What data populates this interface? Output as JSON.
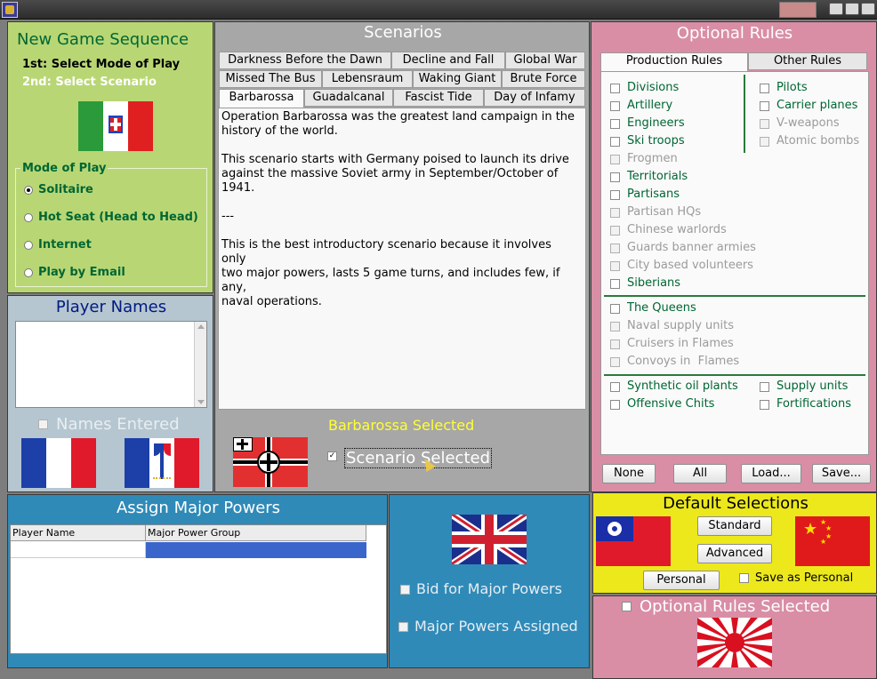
{
  "new_game": {
    "title": "New Game Sequence",
    "step1": "1st: Select Mode of Play",
    "step2": "2nd: Select Scenario",
    "mode_group_label": "Mode of Play",
    "modes": [
      {
        "label": "Solitaire",
        "selected": true
      },
      {
        "label": "Hot Seat (Head to Head)",
        "selected": false
      },
      {
        "label": "Internet",
        "selected": false
      },
      {
        "label": "Play by Email",
        "selected": false
      }
    ]
  },
  "player_names": {
    "title": "Player Names",
    "names_entered_label": "Names Entered"
  },
  "scenarios": {
    "title": "Scenarios",
    "tabs_row1": [
      "Darkness Before the Dawn",
      "Decline and Fall",
      "Global War"
    ],
    "tabs_row2": [
      "Missed The Bus",
      "Lebensraum",
      "Waking Giant",
      "Brute Force"
    ],
    "tabs_row3": [
      "Barbarossa",
      "Guadalcanal",
      "Fascist Tide",
      "Day of Infamy"
    ],
    "selected_tab": "Barbarossa",
    "description_lines": [
      "Operation Barbarossa was the greatest land campaign in the",
      "history of the world.",
      "",
      "This scenario starts with Germany poised to launch its drive",
      "against the massive Soviet army in September/October of",
      "1941.",
      "",
      "---",
      "",
      "This is the best introductory scenario because it involves",
      "only",
      "two major powers, lasts 5 game turns, and includes few, if",
      "any,",
      "naval operations."
    ],
    "selected_status": "Barbarossa Selected",
    "scenario_selected_label": "Scenario Selected",
    "scenario_selected_checked": true
  },
  "optional_rules": {
    "title": "Optional Rules",
    "tabs": [
      "Production Rules",
      "Other Rules"
    ],
    "left_rules": [
      {
        "label": "Divisions",
        "enabled": true
      },
      {
        "label": "Artillery",
        "enabled": true
      },
      {
        "label": "Engineers",
        "enabled": true
      },
      {
        "label": "Ski troops",
        "enabled": true
      },
      {
        "label": "Frogmen",
        "enabled": false
      },
      {
        "label": "Territorials",
        "enabled": true
      },
      {
        "label": "Partisans",
        "enabled": true
      },
      {
        "label": "Partisan HQs",
        "enabled": false
      },
      {
        "label": "Chinese warlords",
        "enabled": false
      },
      {
        "label": "Guards banner armies",
        "enabled": false
      },
      {
        "label": "City based volunteers",
        "enabled": false
      },
      {
        "label": "Siberians",
        "enabled": true
      }
    ],
    "right_rules": [
      {
        "label": "Pilots",
        "enabled": true
      },
      {
        "label": "Carrier planes",
        "enabled": true
      },
      {
        "label": "V-weapons",
        "enabled": false
      },
      {
        "label": "Atomic bombs",
        "enabled": false
      }
    ],
    "naval_rules": [
      {
        "label": "The Queens",
        "enabled": true
      },
      {
        "label": "Naval supply units",
        "enabled": false
      },
      {
        "label": "Cruisers in Flames",
        "enabled": false
      },
      {
        "label": "Convoys in  Flames",
        "enabled": false
      }
    ],
    "bottom_left_rules": [
      {
        "label": "Synthetic oil plants",
        "enabled": true
      },
      {
        "label": "Offensive Chits",
        "enabled": true
      }
    ],
    "bottom_right_rules": [
      {
        "label": "Supply units",
        "enabled": true
      },
      {
        "label": "Fortifications",
        "enabled": true
      }
    ],
    "buttons": [
      "None",
      "All",
      "Load...",
      "Save..."
    ]
  },
  "default_selections": {
    "title": "Default Selections",
    "standard_label": "Standard",
    "advanced_label": "Advanced",
    "personal_label": "Personal",
    "save_as_personal_label": "Save as Personal",
    "optional_rules_selected_label": "Optional Rules Selected"
  },
  "assign_powers": {
    "title": "Assign Major Powers",
    "columns": [
      "Player Name",
      "Major Power Group"
    ],
    "bid_label": "Bid for Major Powers",
    "assigned_label": "Major Powers Assigned"
  },
  "colors": {
    "green_panel": "#b8d774",
    "blue_panel": "#2f8ab8",
    "pink_panel": "#d98ea6",
    "yellow_panel": "#ece81c",
    "gray_panel": "#a7a7a7",
    "player_panel": "#b5c6d0"
  }
}
